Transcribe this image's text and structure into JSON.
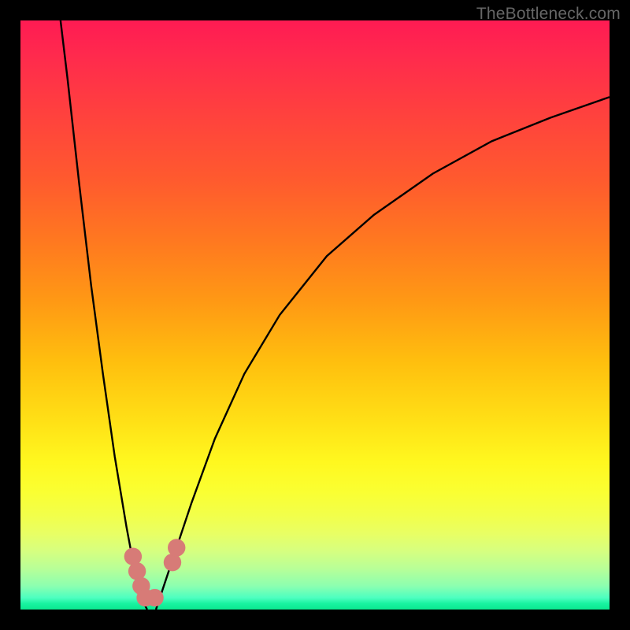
{
  "watermark": "TheBottleneck.com",
  "chart_data": {
    "type": "line",
    "title": "",
    "xlabel": "",
    "ylabel": "",
    "xlim": [
      0,
      100
    ],
    "ylim": [
      0,
      100
    ],
    "background_gradient": {
      "top": "#ff1b53",
      "middle": "#ffe016",
      "bottom": "#0be88f"
    },
    "series": [
      {
        "name": "left-curve",
        "stroke": "#000000",
        "x": [
          6.8,
          8.0,
          10.0,
          12.0,
          14.0,
          16.0,
          18.0,
          19.5,
          20.5,
          21.5
        ],
        "y": [
          100.0,
          90.0,
          72.0,
          55.0,
          40.0,
          26.0,
          14.0,
          6.0,
          2.0,
          0.0
        ]
      },
      {
        "name": "right-curve",
        "stroke": "#000000",
        "x": [
          23.0,
          24.0,
          26.0,
          29.0,
          33.0,
          38.0,
          44.0,
          52.0,
          60.0,
          70.0,
          80.0,
          90.0,
          100.0
        ],
        "y": [
          0.0,
          3.0,
          9.0,
          18.0,
          29.0,
          40.0,
          50.0,
          60.0,
          67.0,
          74.0,
          79.5,
          83.5,
          87.0
        ]
      }
    ],
    "markers": [
      {
        "name": "point-a",
        "x": 19.1,
        "y": 9.0,
        "r": 1.5,
        "color": "#d77b77"
      },
      {
        "name": "point-b",
        "x": 19.8,
        "y": 6.5,
        "r": 1.5,
        "color": "#d77b77"
      },
      {
        "name": "point-c",
        "x": 20.5,
        "y": 4.0,
        "r": 1.5,
        "color": "#d77b77"
      },
      {
        "name": "point-d",
        "x": 21.2,
        "y": 2.0,
        "r": 1.5,
        "color": "#d77b77"
      },
      {
        "name": "point-e",
        "x": 22.8,
        "y": 2.0,
        "r": 1.5,
        "color": "#d77b77"
      },
      {
        "name": "point-f",
        "x": 25.8,
        "y": 8.0,
        "r": 1.5,
        "color": "#d77b77"
      },
      {
        "name": "point-g",
        "x": 26.5,
        "y": 10.5,
        "r": 1.5,
        "color": "#d77b77"
      }
    ]
  }
}
